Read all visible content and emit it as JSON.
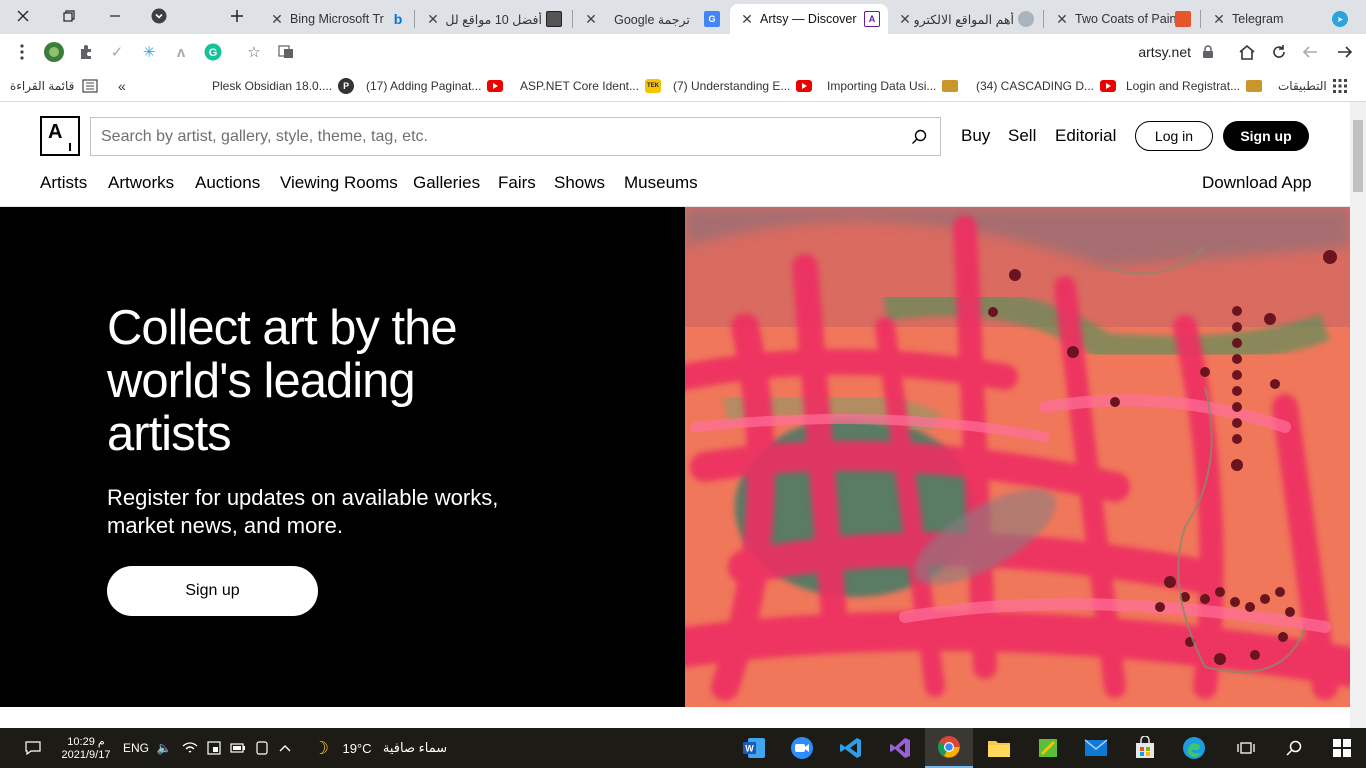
{
  "browser": {
    "tabs": [
      {
        "title": "Telegram",
        "favicon": "telegram-icon"
      },
      {
        "title": "Two Coats of Pain",
        "favicon": "two-coats-icon"
      },
      {
        "title": "أهم المواقع الالكترو",
        "favicon": "cat-icon"
      },
      {
        "title": "Artsy — Discover",
        "favicon": "artsy-icon",
        "active": true
      },
      {
        "title": "Google ترجمة",
        "favicon": "google-translate-icon"
      },
      {
        "title": "أفضل 10 مواقع لل",
        "favicon": "site-icon"
      },
      {
        "title": "Bing Microsoft Tr",
        "favicon": "bing-icon"
      }
    ],
    "url": "artsy.net",
    "bookmarks": [
      {
        "label": "التطبيقات",
        "icon": "apps-icon"
      },
      {
        "label": "Login and Registrat...",
        "icon": "beer-icon"
      },
      {
        "label": "(34) CASCADING D...",
        "icon": "youtube-icon"
      },
      {
        "label": "Importing Data Usi...",
        "icon": "beer-icon"
      },
      {
        "label": "(7) Understanding E...",
        "icon": "youtube-icon"
      },
      {
        "label": "ASP.NET Core Ident...",
        "icon": "tek-icon"
      },
      {
        "label": "(17) Adding Paginat...",
        "icon": "youtube-icon"
      },
      {
        "label": "Plesk Obsidian 18.0....",
        "icon": "plesk-icon"
      }
    ],
    "reading_list": "قائمة القراءة",
    "tek_label": "TEK",
    "plesk_label": "P"
  },
  "artsy": {
    "logo": "A",
    "search_placeholder": "Search by artist, gallery, style, theme, tag, etc.",
    "top_nav": [
      "Buy",
      "Sell",
      "Editorial"
    ],
    "login": "Log in",
    "signup": "Sign up",
    "main_nav": [
      "Artists",
      "Artworks",
      "Auctions",
      "Viewing Rooms",
      "Galleries",
      "Fairs",
      "Shows",
      "Museums"
    ],
    "download": "Download App",
    "hero": {
      "title": "Collect art by the world's leading artists",
      "subtitle": "Register for updates on available works, market news, and more.",
      "cta": "Sign up"
    }
  },
  "taskbar": {
    "time": "10:29 م",
    "date": "2021/9/17",
    "language": "ENG",
    "temperature": "19°C",
    "weather": "سماء صافية"
  },
  "colors": {
    "tabstrip": "#dee1e6",
    "accent_black": "#000000",
    "taskbar": "#1d1b16"
  }
}
